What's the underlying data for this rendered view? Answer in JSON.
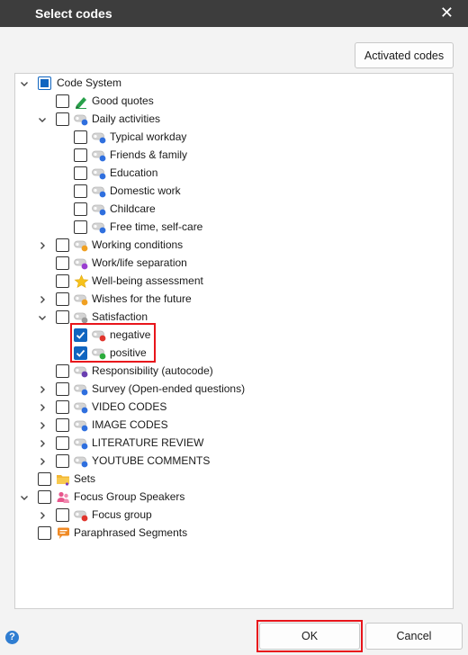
{
  "window": {
    "title": "Select codes",
    "close_glyph": "✕"
  },
  "buttons": {
    "activated_codes": "Activated codes",
    "ok": "OK",
    "cancel": "Cancel",
    "help": "?"
  },
  "tree": [
    {
      "label": "Code System",
      "depth": 0,
      "chev": "down",
      "cb": "partial",
      "icon": "codesystem-icon",
      "name": "tree-item-code-system"
    },
    {
      "label": "Good quotes",
      "depth": 1,
      "chev": "none",
      "cb": "off",
      "icon": "pen-icon",
      "name": "tree-item-good-quotes"
    },
    {
      "label": "Daily activities",
      "depth": 1,
      "chev": "down",
      "cb": "off",
      "icon": "code-icon",
      "color": "#2f6fde",
      "name": "tree-item-daily-activities"
    },
    {
      "label": "Typical workday",
      "depth": 2,
      "chev": "none",
      "cb": "off",
      "icon": "code-icon",
      "color": "#2f6fde",
      "name": "tree-item-typical-workday"
    },
    {
      "label": "Friends & family",
      "depth": 2,
      "chev": "none",
      "cb": "off",
      "icon": "code-icon",
      "color": "#2f6fde",
      "name": "tree-item-friends-family"
    },
    {
      "label": "Education",
      "depth": 2,
      "chev": "none",
      "cb": "off",
      "icon": "code-icon",
      "color": "#2f6fde",
      "name": "tree-item-education"
    },
    {
      "label": "Domestic work",
      "depth": 2,
      "chev": "none",
      "cb": "off",
      "icon": "code-icon",
      "color": "#2f6fde",
      "name": "tree-item-domestic-work"
    },
    {
      "label": "Childcare",
      "depth": 2,
      "chev": "none",
      "cb": "off",
      "icon": "code-icon",
      "color": "#2f6fde",
      "name": "tree-item-childcare"
    },
    {
      "label": "Free time, self-care",
      "depth": 2,
      "chev": "none",
      "cb": "off",
      "icon": "code-icon",
      "color": "#2f6fde",
      "name": "tree-item-free-time"
    },
    {
      "label": "Working conditions",
      "depth": 1,
      "chev": "right",
      "cb": "off",
      "icon": "code-icon",
      "color": "#f0a022",
      "name": "tree-item-working-conditions"
    },
    {
      "label": "Work/life separation",
      "depth": 1,
      "chev": "none",
      "cb": "off",
      "icon": "code-icon",
      "color": "#9a3fd0",
      "name": "tree-item-work-life-separation"
    },
    {
      "label": "Well-being assessment",
      "depth": 1,
      "chev": "none",
      "cb": "off",
      "icon": "star-icon",
      "name": "tree-item-well-being"
    },
    {
      "label": "Wishes for the future",
      "depth": 1,
      "chev": "right",
      "cb": "off",
      "icon": "code-icon",
      "color": "#f0a022",
      "name": "tree-item-wishes"
    },
    {
      "label": "Satisfaction",
      "depth": 1,
      "chev": "down",
      "cb": "off",
      "icon": "code-icon",
      "color": "#9a9a9a",
      "name": "tree-item-satisfaction"
    },
    {
      "label": "negative",
      "depth": 2,
      "chev": "none",
      "cb": "on",
      "icon": "code-icon",
      "color": "#e0342c",
      "name": "tree-item-negative"
    },
    {
      "label": "positive",
      "depth": 2,
      "chev": "none",
      "cb": "on",
      "icon": "code-icon",
      "color": "#2bab3b",
      "name": "tree-item-positive"
    },
    {
      "label": "Responsibility (autocode)",
      "depth": 1,
      "chev": "none",
      "cb": "off",
      "icon": "code-icon",
      "color": "#6a3fb0",
      "name": "tree-item-responsibility"
    },
    {
      "label": "Survey (Open-ended questions)",
      "depth": 1,
      "chev": "right",
      "cb": "off",
      "icon": "code-icon",
      "color": "#2f6fde",
      "name": "tree-item-survey"
    },
    {
      "label": "VIDEO CODES",
      "depth": 1,
      "chev": "right",
      "cb": "off",
      "icon": "code-icon",
      "color": "#2f6fde",
      "name": "tree-item-video-codes"
    },
    {
      "label": "IMAGE CODES",
      "depth": 1,
      "chev": "right",
      "cb": "off",
      "icon": "code-icon",
      "color": "#2f6fde",
      "name": "tree-item-image-codes"
    },
    {
      "label": "LITERATURE REVIEW",
      "depth": 1,
      "chev": "right",
      "cb": "off",
      "icon": "code-icon",
      "color": "#2f6fde",
      "name": "tree-item-literature-review"
    },
    {
      "label": "YOUTUBE COMMENTS",
      "depth": 1,
      "chev": "right",
      "cb": "off",
      "icon": "code-icon",
      "color": "#2f6fde",
      "name": "tree-item-youtube-comments"
    },
    {
      "label": "Sets",
      "depth": 0,
      "chev": "none",
      "cb": "off",
      "icon": "folder-icon",
      "name": "tree-item-sets"
    },
    {
      "label": "Focus Group Speakers",
      "depth": 0,
      "chev": "down",
      "cb": "off",
      "icon": "people-icon",
      "name": "tree-item-focus-group-speakers"
    },
    {
      "label": "Focus group",
      "depth": 1,
      "chev": "right",
      "cb": "off",
      "icon": "code-icon",
      "color": "#e0342c",
      "name": "tree-item-focus-group"
    },
    {
      "label": "Paraphrased Segments",
      "depth": 0,
      "chev": "none",
      "cb": "off",
      "icon": "speech-bubble-icon",
      "name": "tree-item-paraphrased-segments"
    }
  ],
  "colors": {
    "checkbox_checked": "#1065c0",
    "highlight": "#e8151b",
    "titlebar": "#3d3d3d"
  }
}
